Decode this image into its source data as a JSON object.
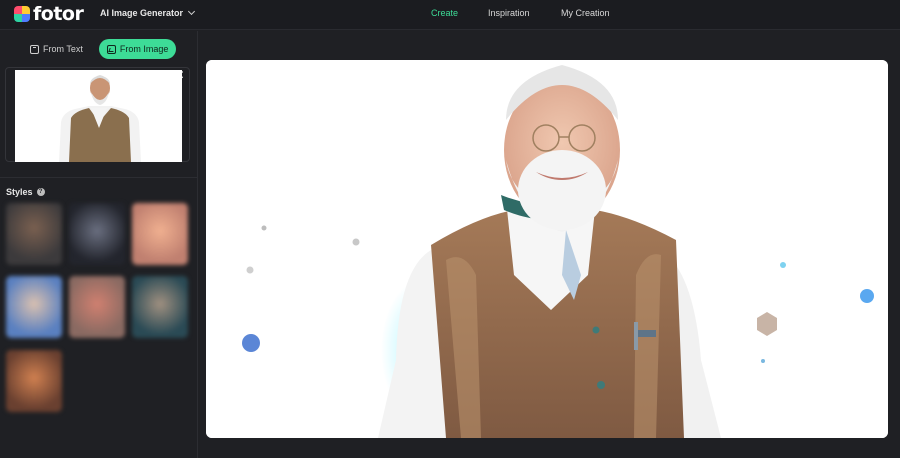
{
  "header": {
    "logo_text": "fotor",
    "product_label": "AI Image Generator",
    "nav": [
      {
        "label": "Create",
        "active": true
      },
      {
        "label": "Inspiration",
        "active": false
      },
      {
        "label": "My Creation",
        "active": false
      }
    ]
  },
  "sidebar": {
    "mode_tabs": [
      {
        "label": "From Text",
        "icon": "text-box-icon",
        "active": false
      },
      {
        "label": "From Image",
        "icon": "image-icon",
        "active": true
      }
    ],
    "upload": {
      "close_label": "✕"
    },
    "styles_label": "Styles",
    "help_label": "?",
    "style_count": 7
  },
  "colors": {
    "accent": "#3ddc97",
    "background": "#1f2024",
    "canvas": "#ffffff"
  }
}
